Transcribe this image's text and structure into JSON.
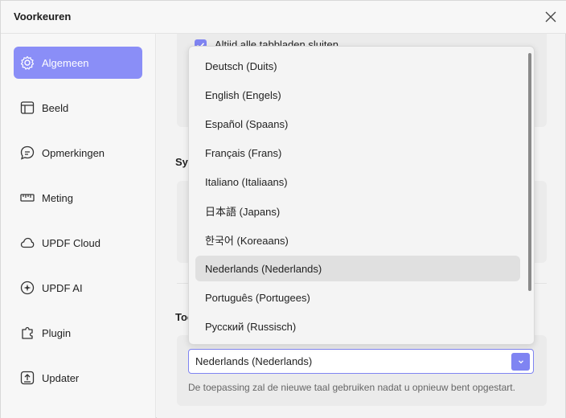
{
  "window": {
    "title": "Voorkeuren"
  },
  "sidebar": {
    "items": [
      {
        "label": "Algemeen",
        "icon": "gear-icon",
        "active": true
      },
      {
        "label": "Beeld",
        "icon": "layout-icon",
        "active": false
      },
      {
        "label": "Opmerkingen",
        "icon": "comment-icon",
        "active": false
      },
      {
        "label": "Meting",
        "icon": "ruler-icon",
        "active": false
      },
      {
        "label": "UPDF Cloud",
        "icon": "cloud-icon",
        "active": false
      },
      {
        "label": "UPDF AI",
        "icon": "ai-sparkle-icon",
        "active": false
      },
      {
        "label": "Plugin",
        "icon": "plugin-icon",
        "active": false
      },
      {
        "label": "Updater",
        "icon": "update-icon",
        "active": false
      }
    ]
  },
  "main": {
    "checkbox_label": "Altijd alle tabbladen sluiten",
    "section_system": "Sys",
    "section_language": "Toe",
    "language_select_value": "Nederlands (Nederlands)",
    "language_hint": "De toepassing zal de nieuwe taal gebruiken nadat u opnieuw bent opgestart."
  },
  "dropdown": {
    "options": [
      "Deutsch (Duits)",
      "English (Engels)",
      "Español (Spaans)",
      "Français (Frans)",
      "Italiano (Italiaans)",
      "日本語 (Japans)",
      "한국어 (Koreaans)",
      "Nederlands (Nederlands)",
      "Português (Portugees)",
      "Русский (Russisch)"
    ],
    "selected_index": 7
  },
  "colors": {
    "accent": "#8a8ef7",
    "accent_dark": "#7f84f2"
  }
}
